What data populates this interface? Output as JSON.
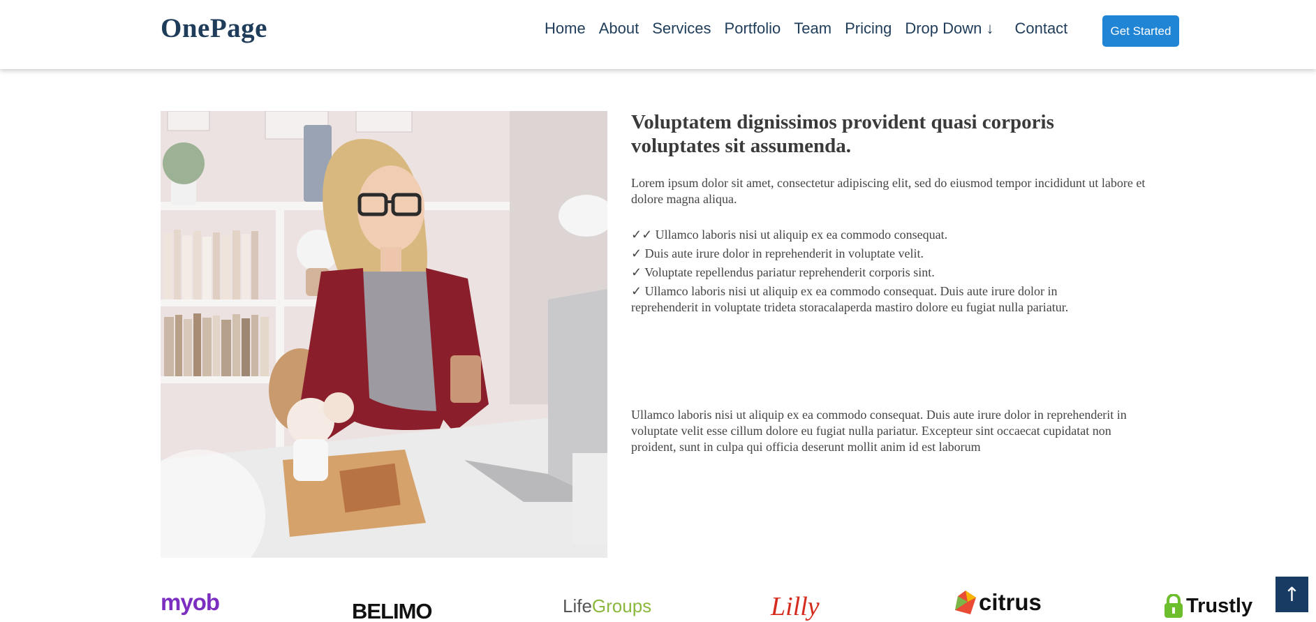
{
  "brand": {
    "name": "OnePage"
  },
  "nav": {
    "items": [
      "Home",
      "About",
      "Services",
      "Portfolio",
      "Team",
      "Pricing",
      "Drop Down ↓",
      "Contact"
    ],
    "cta_label": "Get Started"
  },
  "about": {
    "title": "Voluptatem dignissimos provident quasi corporis voluptates sit assumenda.",
    "intro": "Lorem ipsum dolor sit amet, consectetur adipiscing elit, sed do eiusmod tempor incididunt ut labore et dolore magna aliqua.",
    "checklist": [
      "✓✓ Ullamco laboris nisi ut aliquip ex ea commodo consequat.",
      "✓ Duis aute irure dolor in reprehenderit in voluptate velit.",
      "✓ Voluptate repellendus pariatur reprehenderit corporis sint.",
      "✓ Ullamco laboris nisi ut aliquip ex ea commodo consequat. Duis aute irure dolor in reprehenderit in voluptate trideta storacalaperda mastiro dolore eu fugiat nulla pariatur."
    ],
    "outro": "Ullamco laboris nisi ut aliquip ex ea commodo consequat. Duis aute irure dolor in reprehenderit in voluptate velit esse cillum dolore eu fugiat nulla pariatur. Excepteur sint occaecat cupidatat non proident, sunt in culpa qui officia deserunt mollit anim id est laborum"
  },
  "clients": {
    "myob": "myob",
    "belimo": "BELIMO",
    "lifegroups_a": "Life",
    "lifegroups_b": "Groups",
    "lilly": "Lilly",
    "citrus": "citrus",
    "trustly": "Trustly"
  },
  "back_to_top": {
    "icon": "arrow-up-icon",
    "glyph": "↑"
  },
  "colors": {
    "brand": "#1f3d5a",
    "cta": "#2185d6",
    "back_to_top": "#173b63"
  }
}
